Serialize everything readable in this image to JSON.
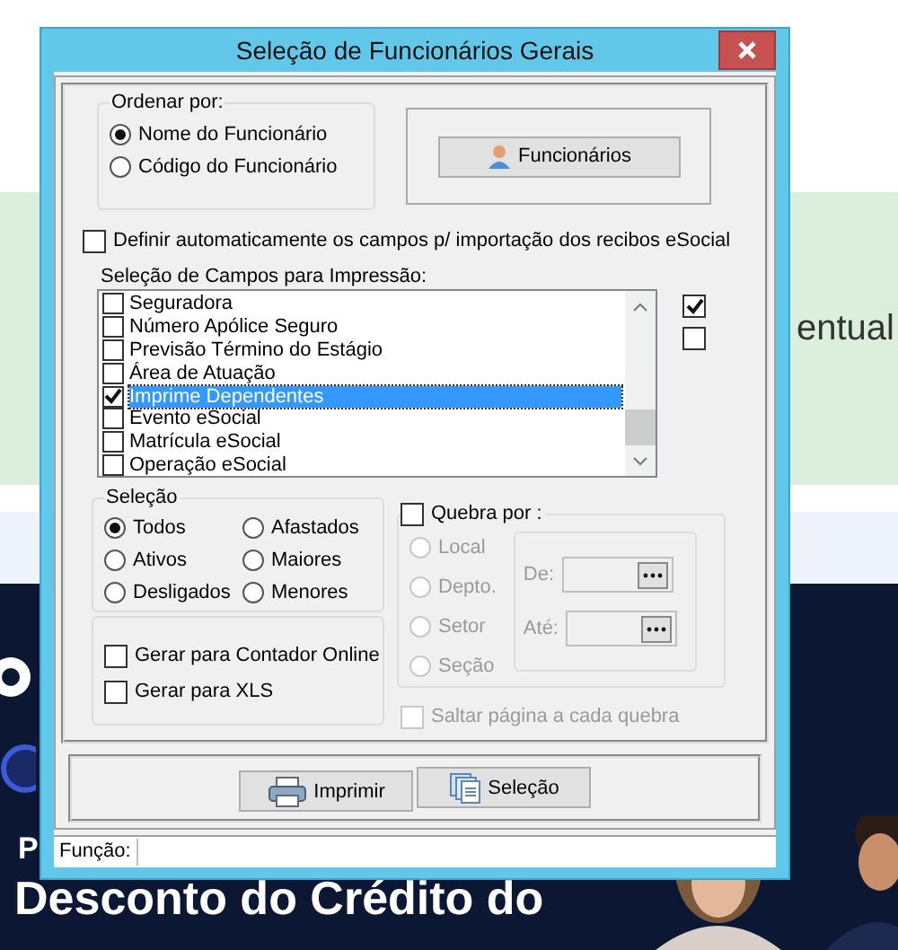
{
  "background": {
    "banner_text": "entual",
    "headline_prefix": "P",
    "headline": [
      "Desconto do Crédito do"
    ]
  },
  "dialog": {
    "title": "Seleção de Funcionários Gerais",
    "order_group": {
      "label": "Ordenar por:",
      "options": [
        {
          "label": "Nome do Funcionário",
          "selected": true
        },
        {
          "label": "Código do Funcionário",
          "selected": false
        }
      ]
    },
    "employees_button": "Funcionários",
    "auto_define": {
      "label": "Definir automaticamente os campos p/ importação dos recibos eSocial",
      "checked": false
    },
    "fields": {
      "label": "Seleção de Campos para Impressão:",
      "items": [
        {
          "label": "Seguradora",
          "checked": false,
          "selected": false
        },
        {
          "label": "Número Apólice Seguro",
          "checked": false,
          "selected": false
        },
        {
          "label": "Previsão Término do Estágio",
          "checked": false,
          "selected": false
        },
        {
          "label": "Área de Atuação",
          "checked": false,
          "selected": false
        },
        {
          "label": "Imprime Dependentes",
          "checked": true,
          "selected": true
        },
        {
          "label": "Evento eSocial",
          "checked": false,
          "selected": false
        },
        {
          "label": "Matrícula eSocial",
          "checked": false,
          "selected": false
        },
        {
          "label": "Operação eSocial",
          "checked": false,
          "selected": false
        }
      ]
    },
    "side_checks": [
      {
        "checked": true
      },
      {
        "checked": false
      }
    ],
    "selection_group": {
      "label": "Seleção",
      "options": [
        {
          "label": "Todos",
          "selected": true
        },
        {
          "label": "Afastados",
          "selected": false
        },
        {
          "label": "Ativos",
          "selected": false
        },
        {
          "label": "Maiores",
          "selected": false
        },
        {
          "label": "Desligados",
          "selected": false
        },
        {
          "label": "Menores",
          "selected": false
        }
      ]
    },
    "export_options": [
      {
        "label": "Gerar para Contador Online",
        "checked": false
      },
      {
        "label": "Gerar para XLS",
        "checked": false
      }
    ],
    "break_group": {
      "label": "Quebra por :",
      "checked": false,
      "options": [
        {
          "label": "Local",
          "selected": false
        },
        {
          "label": "Depto.",
          "selected": false
        },
        {
          "label": "Setor",
          "selected": false
        },
        {
          "label": "Seção",
          "selected": false
        }
      ],
      "from_label": "De:",
      "to_label": "Até:"
    },
    "page_break": {
      "label": "Saltar página a cada quebra",
      "checked": false
    },
    "buttons": [
      {
        "label": "Imprimir",
        "kind": "print"
      },
      {
        "label": "Seleção",
        "kind": "selection"
      }
    ],
    "status": {
      "label": "Função:"
    }
  }
}
